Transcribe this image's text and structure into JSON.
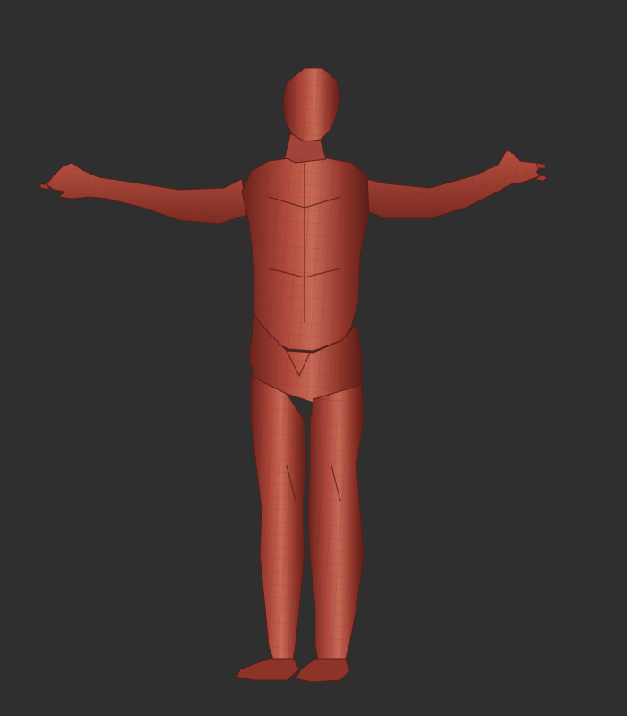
{
  "viewport": {
    "background_color": "#2f2f2f",
    "model": {
      "icon": "male-base-mesh-icon",
      "material_color": "#9a3a2e",
      "highlight_color": "#c86a58",
      "shadow_color": "#5a1d17",
      "wireframe_color": "#6e2820"
    }
  }
}
